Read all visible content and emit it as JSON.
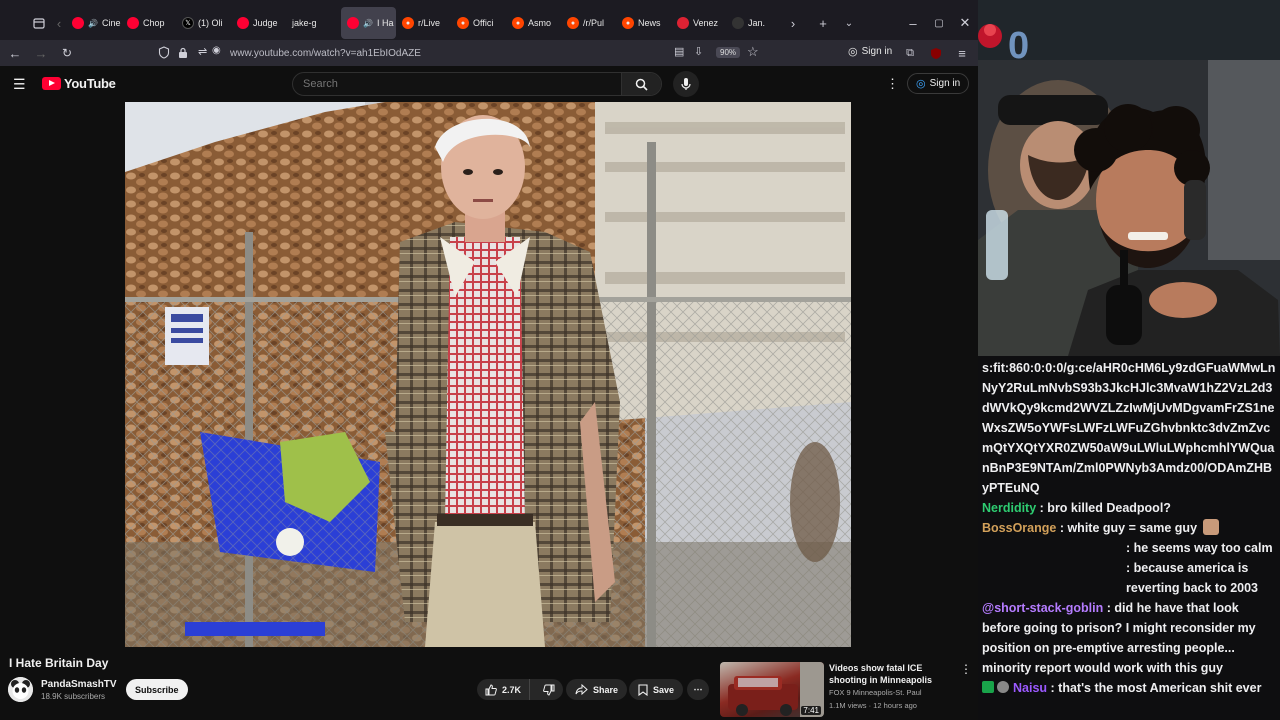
{
  "browser": {
    "tabs": [
      {
        "label": "Cinem",
        "icon": "youtube"
      },
      {
        "label": "Chop",
        "icon": "youtube"
      },
      {
        "label": "(1) Oli",
        "icon": "x"
      },
      {
        "label": "Judge",
        "icon": "youtube"
      },
      {
        "label": "jake-g",
        "icon": "none"
      },
      {
        "label": "I Ha",
        "icon": "youtube",
        "active": true
      },
      {
        "label": "r/Live",
        "icon": "reddit"
      },
      {
        "label": "Offici",
        "icon": "reddit"
      },
      {
        "label": "Asmo",
        "icon": "reddit"
      },
      {
        "label": "/r/Pul",
        "icon": "reddit"
      },
      {
        "label": "News",
        "icon": "reddit"
      },
      {
        "label": "Venez",
        "icon": "pink"
      },
      {
        "label": "Jan. ",
        "icon": "dark"
      }
    ],
    "url": "www.youtube.com/watch?v=ah1EbIOdAZE",
    "zoom": "90%",
    "signin_label": "Sign in"
  },
  "youtube": {
    "logo_text": "YouTube",
    "search_placeholder": "Search",
    "signin_label": "Sign in",
    "video_title": "I Hate Britain Day",
    "channel_name": "PandaSmashTV",
    "subscribers": "18.9K subscribers",
    "subscribe_label": "Subscribe",
    "likes": "2.7K",
    "share_label": "Share",
    "save_label": "Save",
    "recommended": {
      "title": "Videos show fatal ICE shooting in Minneapolis",
      "channel": "FOX 9 Minneapolis-St. Paul",
      "meta": "1.1M views · 12 hours ago",
      "duration": "7:41"
    }
  },
  "chat": {
    "messages": [
      {
        "user": "",
        "text": "s:fit:860:0:0:0/g:ce/aHR0cHM6Ly9zdGFuaWMwLnNyY2RuLmNvbS93b3JkcHJlc3MvaW1hZ2VzL2d3dWVkQy9kcmd2WVZLZzIwMjUvMDgvamFrZS1neWxsZW5oYWFsLWFzLWFuZGhvbnktc3dvZmZvcmQtYXQtYXR0ZW50aW9uLWluLWphcmhlYWQuanBnP3E9NTAm/Zml0PWNyb3Amdz00/ODAmZHByPTEuNQ",
        "color": "#efeff1"
      },
      {
        "user": "Nerdidity",
        "text": ": bro killed Deadpool?",
        "color": "#2ecc71"
      },
      {
        "user": "BossOrange",
        "text": ": white guy = same guy",
        "color": "#d2a05a",
        "emote": true
      },
      {
        "user": "",
        "text": ": he seems way too calm",
        "color": "#efeff1",
        "indent": true
      },
      {
        "user": "",
        "text": ": because america is reverting back to 2003",
        "color": "#efeff1",
        "indent": true
      },
      {
        "user": "@short-stack-goblin",
        "text": ": did he have that look before going to prison? I might reconsider my position on pre-emptive arresting people... minority report would work with this guy",
        "color": "#b57cff"
      },
      {
        "user": "Naisu",
        "text": ": that's the most American shit ever",
        "color": "#9b59ff",
        "badges": true
      }
    ]
  }
}
